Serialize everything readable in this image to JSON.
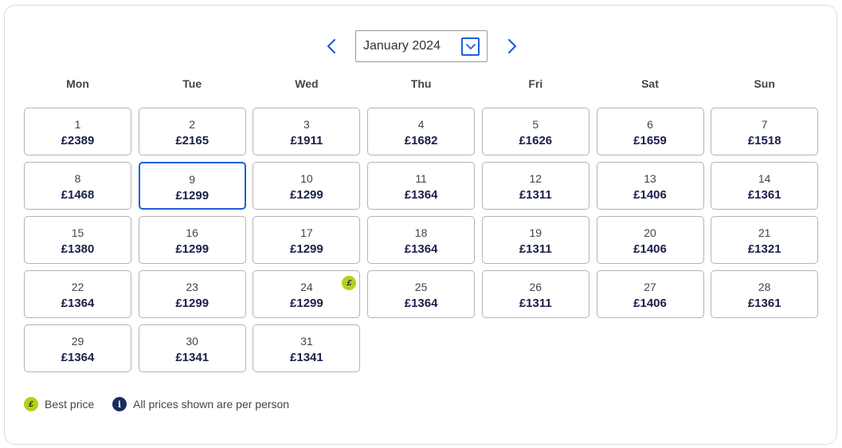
{
  "month_nav": {
    "selected_month": "January 2024"
  },
  "weekdays": [
    "Mon",
    "Tue",
    "Wed",
    "Thu",
    "Fri",
    "Sat",
    "Sun"
  ],
  "days": [
    {
      "day": "1",
      "price": "£2389"
    },
    {
      "day": "2",
      "price": "£2165"
    },
    {
      "day": "3",
      "price": "£1911"
    },
    {
      "day": "4",
      "price": "£1682"
    },
    {
      "day": "5",
      "price": "£1626"
    },
    {
      "day": "6",
      "price": "£1659"
    },
    {
      "day": "7",
      "price": "£1518"
    },
    {
      "day": "8",
      "price": "£1468"
    },
    {
      "day": "9",
      "price": "£1299",
      "selected": true
    },
    {
      "day": "10",
      "price": "£1299"
    },
    {
      "day": "11",
      "price": "£1364"
    },
    {
      "day": "12",
      "price": "£1311"
    },
    {
      "day": "13",
      "price": "£1406"
    },
    {
      "day": "14",
      "price": "£1361"
    },
    {
      "day": "15",
      "price": "£1380"
    },
    {
      "day": "16",
      "price": "£1299"
    },
    {
      "day": "17",
      "price": "£1299"
    },
    {
      "day": "18",
      "price": "£1364"
    },
    {
      "day": "19",
      "price": "£1311"
    },
    {
      "day": "20",
      "price": "£1406"
    },
    {
      "day": "21",
      "price": "£1321"
    },
    {
      "day": "22",
      "price": "£1364"
    },
    {
      "day": "23",
      "price": "£1299"
    },
    {
      "day": "24",
      "price": "£1299",
      "best": true
    },
    {
      "day": "25",
      "price": "£1364"
    },
    {
      "day": "26",
      "price": "£1311"
    },
    {
      "day": "27",
      "price": "£1406"
    },
    {
      "day": "28",
      "price": "£1361"
    },
    {
      "day": "29",
      "price": "£1364"
    },
    {
      "day": "30",
      "price": "£1341"
    },
    {
      "day": "31",
      "price": "£1341"
    }
  ],
  "best_badge_symbol": "£",
  "legend": {
    "best_symbol": "£",
    "best_label": "Best price",
    "info_symbol": "i",
    "info_label": "All prices shown are per person"
  },
  "colors": {
    "accent": "#1c5fd9",
    "best_price": "#b4d118",
    "price_text": "#1a1f4a",
    "info_icon": "#1a2c5e"
  }
}
